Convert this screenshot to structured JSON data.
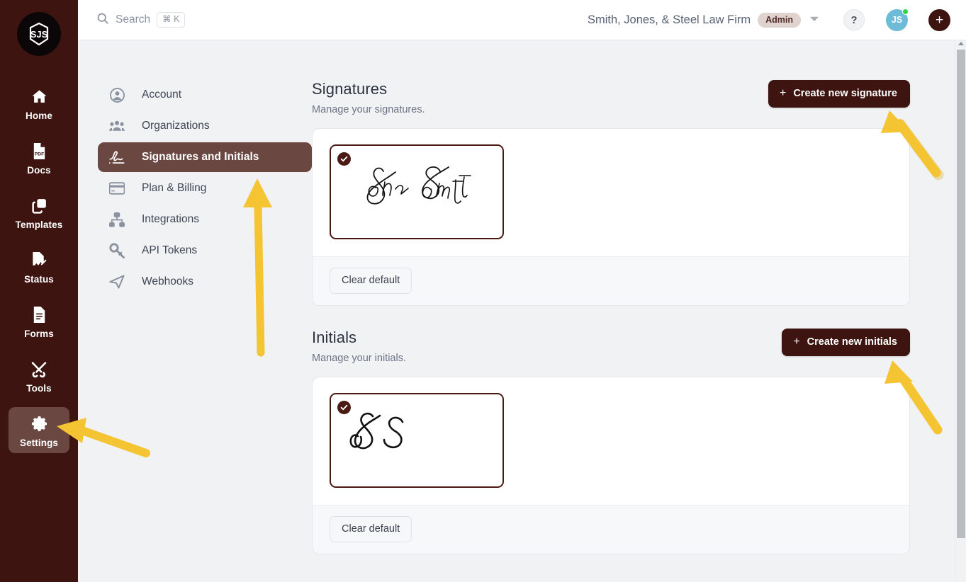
{
  "brand": {
    "logo_text": "SJS",
    "primary_color": "#3d1410",
    "accent_active": "#6a4740",
    "annotation_color": "#f5c432"
  },
  "rail": {
    "items": [
      {
        "label": "Home",
        "icon": "home-icon",
        "active": false
      },
      {
        "label": "Docs",
        "icon": "pdf-document-icon",
        "active": false
      },
      {
        "label": "Templates",
        "icon": "templates-copy-icon",
        "active": false
      },
      {
        "label": "Status",
        "icon": "signed-document-icon",
        "active": false
      },
      {
        "label": "Forms",
        "icon": "form-lines-icon",
        "active": false
      },
      {
        "label": "Tools",
        "icon": "tools-wrench-screwdriver-icon",
        "active": false
      },
      {
        "label": "Settings",
        "icon": "gear-icon",
        "active": true
      }
    ]
  },
  "topbar": {
    "search": {
      "label": "Search",
      "shortcut": "⌘ K",
      "icon": "search-icon"
    },
    "org_name": "Smith, Jones, & Steel Law Firm",
    "org_role_badge": "Admin",
    "org_caret_icon": "chevron-down-icon",
    "help_label": "?",
    "avatar_initials": "JS",
    "avatar_status": "online",
    "add_label": "+"
  },
  "settings_nav": {
    "items": [
      {
        "label": "Account",
        "icon": "user-circle-icon",
        "active": false
      },
      {
        "label": "Organizations",
        "icon": "people-group-icon",
        "active": false
      },
      {
        "label": "Signatures and Initials",
        "icon": "signature-icon",
        "active": true
      },
      {
        "label": "Plan & Billing",
        "icon": "credit-card-icon",
        "active": false
      },
      {
        "label": "Integrations",
        "icon": "sitemap-icon",
        "active": false
      },
      {
        "label": "API Tokens",
        "icon": "key-icon",
        "active": false
      },
      {
        "label": "Webhooks",
        "icon": "webhook-send-icon",
        "active": false
      }
    ]
  },
  "sections": [
    {
      "title": "Signatures",
      "subtitle": "Manage your signatures.",
      "create_button": "Create new signature",
      "create_button_icon": "plus-icon",
      "clear_button": "Clear default",
      "item": {
        "name": "John Smith",
        "is_default": true,
        "default_badge_icon": "check-circle-icon"
      }
    },
    {
      "title": "Initials",
      "subtitle": "Manage your initials.",
      "create_button": "Create new initials",
      "create_button_icon": "plus-icon",
      "clear_button": "Clear default",
      "item": {
        "name": "JS",
        "is_default": true,
        "default_badge_icon": "check-circle-icon"
      }
    }
  ],
  "annotations": {
    "arrow_count": 4,
    "targets": [
      "create-new-signature-button",
      "settings-nav-item-signatures-and-initials",
      "rail-item-settings",
      "create-new-initials-button"
    ]
  }
}
